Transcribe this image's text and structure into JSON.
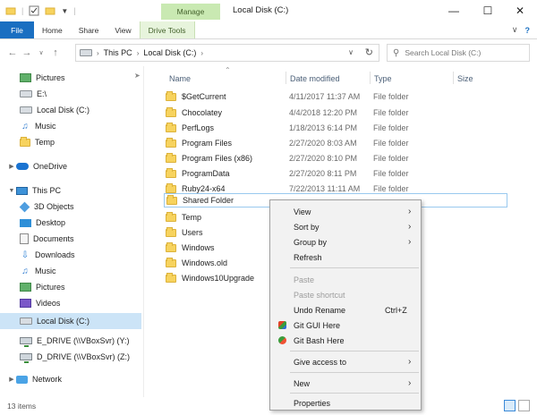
{
  "window": {
    "title": "Local Disk (C:)",
    "contextual_tab": "Manage",
    "minimize_icon": "minimize-icon",
    "maximize_icon": "maximize-icon",
    "close_icon": "close-icon"
  },
  "ribbon": {
    "tabs": [
      "File",
      "Home",
      "Share",
      "View",
      "Drive Tools"
    ]
  },
  "address": {
    "crumbs": [
      "This PC",
      "Local Disk (C:)"
    ],
    "search_placeholder": "Search Local Disk (C:)"
  },
  "sidebar": {
    "items": [
      {
        "label": "Pictures",
        "icon": "pictures-icon",
        "pinned": true
      },
      {
        "label": "E:\\",
        "icon": "drive-icon"
      },
      {
        "label": "Local Disk (C:)",
        "icon": "drive-icon"
      },
      {
        "label": "Music",
        "icon": "music-icon"
      },
      {
        "label": "Temp",
        "icon": "folder-icon"
      },
      {
        "label": "OneDrive",
        "icon": "onedrive-icon"
      },
      {
        "label": "This PC",
        "icon": "pc-icon"
      },
      {
        "label": "3D Objects",
        "icon": "3d-objects-icon"
      },
      {
        "label": "Desktop",
        "icon": "desktop-icon"
      },
      {
        "label": "Documents",
        "icon": "documents-icon"
      },
      {
        "label": "Downloads",
        "icon": "downloads-icon"
      },
      {
        "label": "Music",
        "icon": "music-icon"
      },
      {
        "label": "Pictures",
        "icon": "pictures-icon"
      },
      {
        "label": "Videos",
        "icon": "videos-icon"
      },
      {
        "label": "Local Disk (C:)",
        "icon": "drive-icon",
        "selected": true
      },
      {
        "label": "E_DRIVE (\\\\VBoxSvr) (Y:)",
        "icon": "network-drive-icon"
      },
      {
        "label": "D_DRIVE (\\\\VBoxSvr) (Z:)",
        "icon": "network-drive-icon"
      },
      {
        "label": "Network",
        "icon": "network-icon"
      }
    ]
  },
  "columns": {
    "name": "Name",
    "date": "Date modified",
    "type": "Type",
    "size": "Size"
  },
  "files": [
    {
      "name": "$GetCurrent",
      "date": "4/11/2017 11:37 AM",
      "type": "File folder"
    },
    {
      "name": "Chocolatey",
      "date": "4/4/2018 12:20 PM",
      "type": "File folder"
    },
    {
      "name": "PerfLogs",
      "date": "1/18/2013 6:14 PM",
      "type": "File folder"
    },
    {
      "name": "Program Files",
      "date": "2/27/2020 8:03 AM",
      "type": "File folder"
    },
    {
      "name": "Program Files (x86)",
      "date": "2/27/2020 8:10 PM",
      "type": "File folder"
    },
    {
      "name": "ProgramData",
      "date": "2/27/2020 8:11 PM",
      "type": "File folder"
    },
    {
      "name": "Ruby24-x64",
      "date": "7/22/2013 11:11 AM",
      "type": "File folder"
    },
    {
      "name": "Shared Folder",
      "date": "",
      "type": "",
      "selected": true
    },
    {
      "name": "Temp",
      "date": "",
      "type": ""
    },
    {
      "name": "Users",
      "date": "",
      "type": ""
    },
    {
      "name": "Windows",
      "date": "",
      "type": ""
    },
    {
      "name": "Windows.old",
      "date": "",
      "type": ""
    },
    {
      "name": "Windows10Upgrade",
      "date": "",
      "type": ""
    }
  ],
  "context_menu": {
    "view": "View",
    "sort_by": "Sort by",
    "group_by": "Group by",
    "refresh": "Refresh",
    "paste": "Paste",
    "paste_shortcut": "Paste shortcut",
    "undo_rename": "Undo Rename",
    "undo_accel": "Ctrl+Z",
    "git_gui": "Git GUI Here",
    "git_bash": "Git Bash Here",
    "give_access": "Give access to",
    "new": "New",
    "properties": "Properties"
  },
  "status": {
    "item_count": "13 items"
  },
  "colors": {
    "file_tab": "#1a6fc1",
    "manage_tab": "#c9e9b2",
    "selection": "#cce4f7"
  }
}
